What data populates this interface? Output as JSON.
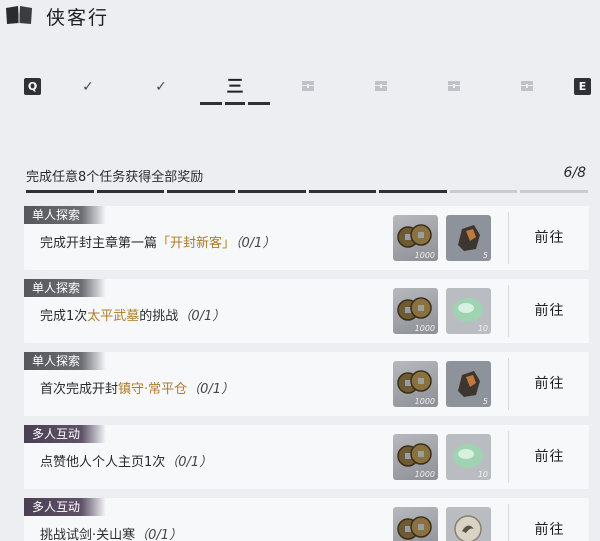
{
  "header": {
    "title": "侠客行"
  },
  "tabs": {
    "left_key": "Q",
    "right_key": "E",
    "items": [
      {
        "label": "✓",
        "state": "done"
      },
      {
        "label": "✓",
        "state": "done"
      },
      {
        "label": "三",
        "state": "active"
      },
      {
        "label": "",
        "state": "locked"
      },
      {
        "label": "",
        "state": "locked"
      },
      {
        "label": "",
        "state": "locked"
      },
      {
        "label": "",
        "state": "locked"
      }
    ]
  },
  "progress": {
    "text": "完成任意8个任务获得全部奖励",
    "count": "6/8",
    "filled": 6,
    "total": 8
  },
  "tasks": [
    {
      "tag": "单人探索",
      "tag_type": "solo",
      "desc_pre": "完成开封主章第一篇",
      "desc_hl": "「开封新客」",
      "desc_post": "",
      "count": "（0/1）",
      "coin_qty": "1000",
      "item": "ore",
      "item_qty": "5",
      "button": "前往"
    },
    {
      "tag": "单人探索",
      "tag_type": "solo",
      "desc_pre": "完成1次",
      "desc_hl": "太平武墓",
      "desc_post": "的挑战",
      "count": "（0/1）",
      "coin_qty": "1000",
      "item": "jade",
      "item_qty": "10",
      "button": "前往"
    },
    {
      "tag": "单人探索",
      "tag_type": "solo",
      "desc_pre": "首次完成开封",
      "desc_hl": "镇守·常平仓",
      "desc_post": "",
      "count": "（0/1）",
      "coin_qty": "1000",
      "item": "ore",
      "item_qty": "5",
      "button": "前往"
    },
    {
      "tag": "多人互动",
      "tag_type": "multi",
      "desc_pre": "点赞他人个人主页1次",
      "desc_hl": "",
      "desc_post": "",
      "count": "（0/1）",
      "coin_qty": "1000",
      "item": "jade",
      "item_qty": "10",
      "button": "前往"
    },
    {
      "tag": "多人互动",
      "tag_type": "multi",
      "desc_pre": "挑战试剑·关山寒",
      "desc_hl": "",
      "desc_post": "",
      "count": "（0/1）",
      "coin_qty": "",
      "item": "token",
      "item_qty": "",
      "button": "前往"
    }
  ],
  "colors": {
    "accent": "#b07a2a",
    "dark": "#2f3136",
    "background": "#eceef1"
  },
  "icons": {
    "header": "book-icon",
    "locked_tab": "locked-chest-icon",
    "coins": "copper-coins-icon",
    "ore": "ore-icon",
    "jade": "jade-icon",
    "token": "token-icon"
  }
}
